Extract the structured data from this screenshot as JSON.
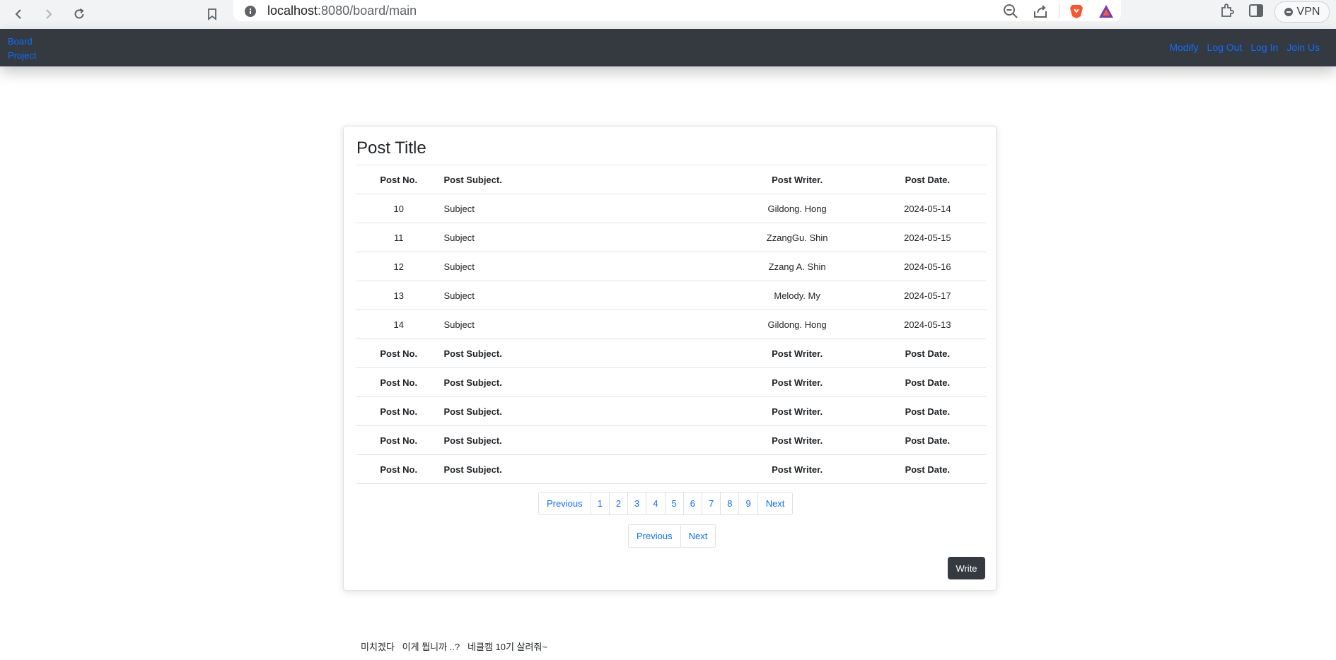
{
  "browser": {
    "url_host": "localhost",
    "url_path": ":8080/board/main",
    "vpn_label": "VPN"
  },
  "navbar": {
    "brand_line1": "Board",
    "brand_line2": "Project",
    "links": [
      "Modify",
      "Log Out",
      "Log In",
      "Join Us"
    ],
    "bg_color": "#343a40",
    "link_color": "#0d6efd"
  },
  "card": {
    "title": "Post Title",
    "columns": [
      "Post No.",
      "Post Subject.",
      "Post Writer.",
      "Post Date."
    ],
    "rows": [
      [
        "10",
        "Subject",
        "Gildong. Hong",
        "2024-05-14"
      ],
      [
        "11",
        "Subject",
        "ZzangGu. Shin",
        "2024-05-15"
      ],
      [
        "12",
        "Subject",
        "Zzang A. Shin",
        "2024-05-16"
      ],
      [
        "13",
        "Subject",
        "Melody. My",
        "2024-05-17"
      ],
      [
        "14",
        "Subject",
        "Gildong. Hong",
        "2024-05-13"
      ]
    ],
    "repeated_header_rows": [
      [
        "Post No.",
        "Post Subject.",
        "Post Writer.",
        "Post Date."
      ],
      [
        "Post No.",
        "Post Subject.",
        "Post Writer.",
        "Post Date."
      ],
      [
        "Post No.",
        "Post Subject.",
        "Post Writer.",
        "Post Date."
      ],
      [
        "Post No.",
        "Post Subject.",
        "Post Writer.",
        "Post Date."
      ],
      [
        "Post No.",
        "Post Subject.",
        "Post Writer.",
        "Post Date."
      ]
    ],
    "pagination": {
      "previous": "Previous",
      "next": "Next",
      "pages": [
        "1",
        "2",
        "3",
        "4",
        "5",
        "6",
        "7",
        "8",
        "9"
      ]
    },
    "pagination_simple": {
      "previous": "Previous",
      "next": "Next"
    },
    "write_label": "Write"
  },
  "footer": {
    "text": "미치겠다   이게 뭡니까 ..?   네클캠 10기 살려줘~"
  }
}
